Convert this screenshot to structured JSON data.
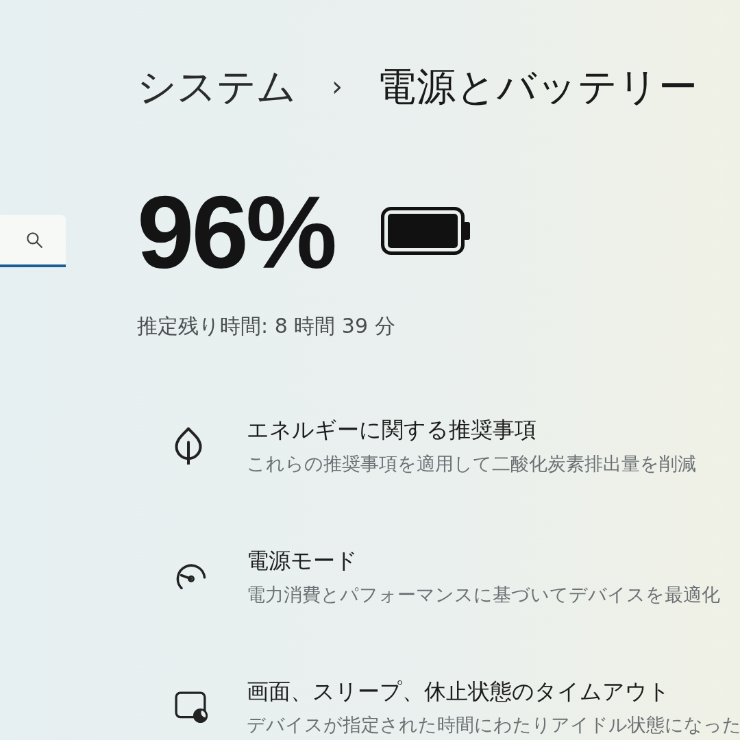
{
  "breadcrumb": {
    "parent": "システム",
    "separator": "›",
    "current": "電源とバッテリー"
  },
  "battery": {
    "percent": "96%",
    "estimate": "推定残り時間: 8 時間 39 分"
  },
  "settings": [
    {
      "title": "エネルギーに関する推奨事項",
      "description": "これらの推奨事項を適用して二酸化炭素排出量を削減"
    },
    {
      "title": "電源モード",
      "description": "電力消費とパフォーマンスに基づいてデバイスを最適化"
    },
    {
      "title": "画面、スリープ、休止状態のタイムアウト",
      "description": "デバイスが指定された時間にわたりアイドル状態になった"
    }
  ]
}
